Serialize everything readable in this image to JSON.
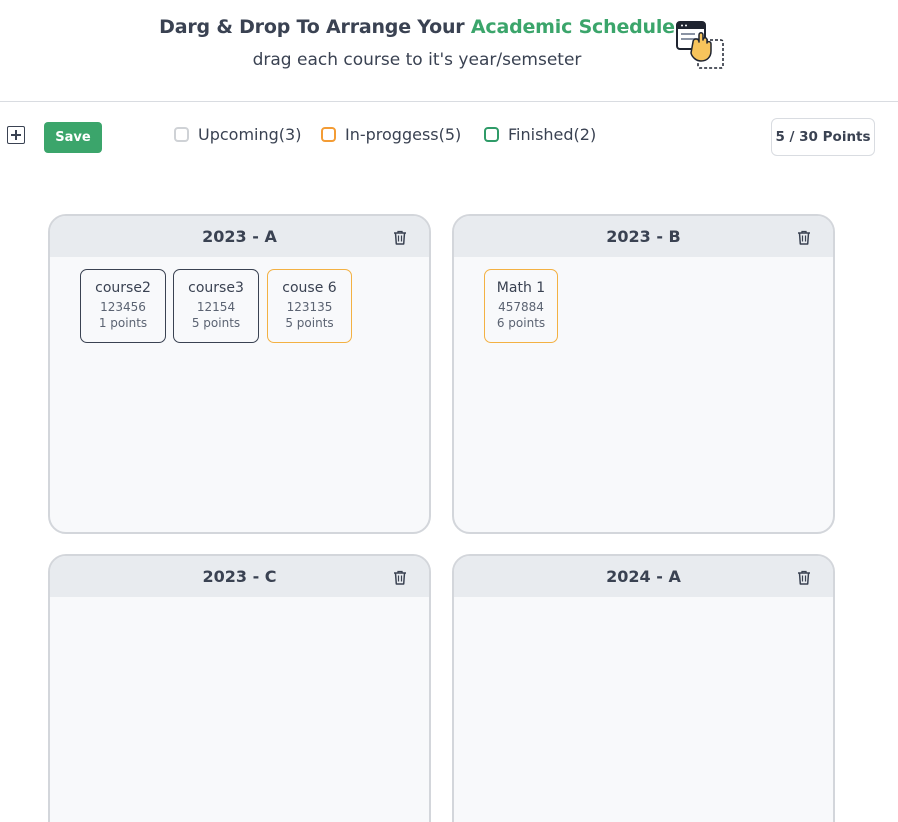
{
  "header": {
    "title_prefix": "Darg & Drop To Arrange Your ",
    "title_accent": "Academic Schedule",
    "subtitle": "drag each course to it's year/semseter",
    "illustration_icon": "drag-window-hand-icon"
  },
  "toolbar": {
    "add_icon": "plus-square-icon",
    "save_label": "Save",
    "legend": [
      {
        "label": "Upcoming(3)",
        "color": "#cfd2d6"
      },
      {
        "label": "In-proggess(5)",
        "color": "#f39c35"
      },
      {
        "label": "Finished(2)",
        "color": "#2f9b68"
      }
    ],
    "points": "5 / 30 Points"
  },
  "colors": {
    "accent": "#3ba56b",
    "upcoming_border": "#3a4252",
    "inprogress_border": "#f3b143"
  },
  "semesters": [
    {
      "title": "2023 - A",
      "courses": [
        {
          "name": "course2",
          "code": "123456",
          "points": "1 points",
          "status": "upcoming"
        },
        {
          "name": "course3",
          "code": "12154",
          "points": "5 points",
          "status": "upcoming"
        },
        {
          "name": "couse 6",
          "code": "123135",
          "points": "5 points",
          "status": "in-progress"
        }
      ]
    },
    {
      "title": "2023 - B",
      "courses": [
        {
          "name": "Math 1",
          "code": "457884",
          "points": "6 points",
          "status": "in-progress"
        }
      ]
    },
    {
      "title": "2023 - C",
      "courses": []
    },
    {
      "title": "2024 - A",
      "courses": []
    }
  ]
}
